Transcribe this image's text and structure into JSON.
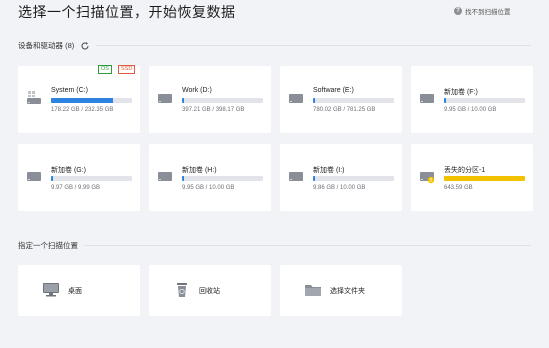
{
  "header": {
    "title": "选择一个扫描位置，开始恢复数据",
    "help_icon": "question-circle-icon",
    "help_text": "找不到扫描位置"
  },
  "devices_section": {
    "label": "设备和驱动器 (8)",
    "refresh_icon": "refresh-icon"
  },
  "drives": [
    {
      "name": "System (C:)",
      "size": "178.22 GB / 232.35 GB",
      "usage_fraction": 0.77,
      "badges": [
        "OS",
        "SSD"
      ],
      "icon": "windows-drive-icon"
    },
    {
      "name": "Work (D:)",
      "size": "397.21 GB / 398.17 GB",
      "usage_fraction": 0.02,
      "icon": "hard-drive-icon"
    },
    {
      "name": "Software (E:)",
      "size": "780.02 GB / 781.25 GB",
      "usage_fraction": 0.02,
      "icon": "hard-drive-icon"
    },
    {
      "name": "新加卷 (F:)",
      "size": "9.95 GB / 10.00 GB",
      "usage_fraction": 0.02,
      "icon": "hard-drive-icon"
    },
    {
      "name": "新加卷 (G:)",
      "size": "9.97 GB / 9.99 GB",
      "usage_fraction": 0.02,
      "icon": "hard-drive-icon"
    },
    {
      "name": "新加卷 (H:)",
      "size": "9.95 GB / 10.00 GB",
      "usage_fraction": 0.02,
      "icon": "hard-drive-icon"
    },
    {
      "name": "新加卷 (I:)",
      "size": "9.86 GB / 10.00 GB",
      "usage_fraction": 0.02,
      "icon": "hard-drive-icon"
    },
    {
      "name": "丢失的分区-1",
      "size": "643.59 GB",
      "usage_fraction": 1.0,
      "bar_color": "#f2c200",
      "icon": "lost-partition-icon"
    }
  ],
  "locations_section": {
    "label": "指定一个扫描位置"
  },
  "locations": [
    {
      "label": "桌面",
      "icon": "desktop-icon"
    },
    {
      "label": "回收站",
      "icon": "recycle-bin-icon"
    },
    {
      "label": "选择文件夹",
      "icon": "folder-icon"
    }
  ],
  "colors": {
    "accent": "#2d83e0",
    "lost_partition": "#f2c200",
    "os_badge": "#2c9c3d",
    "ssd_badge": "#e05a3d"
  }
}
